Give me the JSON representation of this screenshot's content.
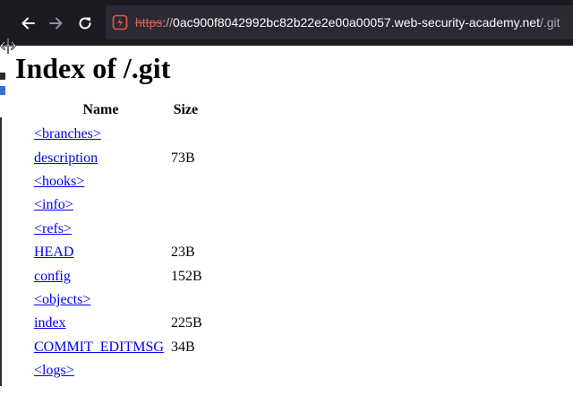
{
  "browser": {
    "url": {
      "scheme": "https",
      "separator": "://",
      "host": "0ac900f8042992bc82b22e2e00a00057.web-security-academy.net",
      "path": "/.git"
    },
    "icons": {
      "back": "back-arrow-icon",
      "forward": "forward-arrow-icon",
      "reload": "reload-icon",
      "insecure": "insecure-connection-icon"
    }
  },
  "page": {
    "title": "Index of /.git",
    "columns": {
      "name": "Name",
      "size": "Size"
    },
    "entries": [
      {
        "name": "<branches>",
        "size": ""
      },
      {
        "name": "description",
        "size": "73B"
      },
      {
        "name": "<hooks>",
        "size": ""
      },
      {
        "name": "<info>",
        "size": ""
      },
      {
        "name": "<refs>",
        "size": ""
      },
      {
        "name": "HEAD",
        "size": "23B"
      },
      {
        "name": "config",
        "size": "152B"
      },
      {
        "name": "<objects>",
        "size": ""
      },
      {
        "name": "index",
        "size": "225B"
      },
      {
        "name": "COMMIT_EDITMSG",
        "size": "34B"
      },
      {
        "name": "<logs>",
        "size": ""
      }
    ]
  },
  "colors": {
    "toolbar_bg": "#1c1b22",
    "urlbar_bg": "#2b2a33",
    "insecure_accent": "#e05a4e",
    "link": "#0000ee"
  }
}
